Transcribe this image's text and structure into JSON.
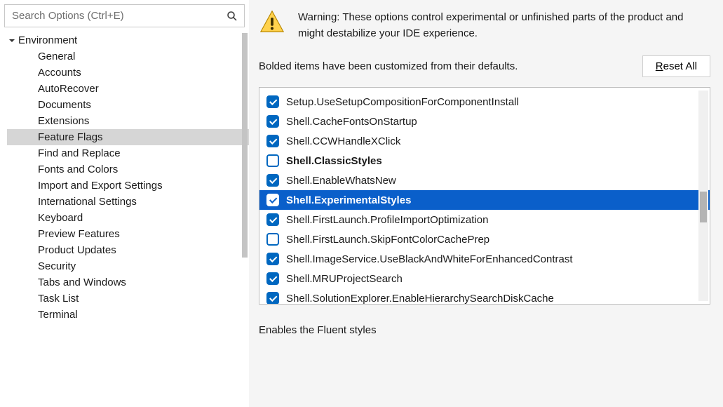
{
  "search": {
    "placeholder": "Search Options (Ctrl+E)"
  },
  "tree": {
    "root_label": "Environment",
    "children": [
      "General",
      "Accounts",
      "AutoRecover",
      "Documents",
      "Extensions",
      "Feature Flags",
      "Find and Replace",
      "Fonts and Colors",
      "Import and Export Settings",
      "International Settings",
      "Keyboard",
      "Preview Features",
      "Product Updates",
      "Security",
      "Tabs and Windows",
      "Task List",
      "Terminal"
    ],
    "selected_index": 5
  },
  "warning": {
    "text": "Warning: These options control experimental or unfinished parts of the product and might destabilize your IDE experience."
  },
  "info_text": "Bolded items have been customized from their defaults.",
  "reset_button": {
    "mnemonic": "R",
    "rest": "eset All"
  },
  "flags": [
    {
      "name": "Setup.UseSetupCompositionForComponentInstall",
      "checked": true,
      "bold": false,
      "selected": false
    },
    {
      "name": "Shell.CacheFontsOnStartup",
      "checked": true,
      "bold": false,
      "selected": false
    },
    {
      "name": "Shell.CCWHandleXClick",
      "checked": true,
      "bold": false,
      "selected": false
    },
    {
      "name": "Shell.ClassicStyles",
      "checked": false,
      "bold": true,
      "selected": false
    },
    {
      "name": "Shell.EnableWhatsNew",
      "checked": true,
      "bold": false,
      "selected": false
    },
    {
      "name": "Shell.ExperimentalStyles",
      "checked": true,
      "bold": true,
      "selected": true
    },
    {
      "name": "Shell.FirstLaunch.ProfileImportOptimization",
      "checked": true,
      "bold": false,
      "selected": false
    },
    {
      "name": "Shell.FirstLaunch.SkipFontColorCachePrep",
      "checked": false,
      "bold": false,
      "selected": false
    },
    {
      "name": "Shell.ImageService.UseBlackAndWhiteForEnhancedContrast",
      "checked": true,
      "bold": false,
      "selected": false
    },
    {
      "name": "Shell.MRUProjectSearch",
      "checked": true,
      "bold": false,
      "selected": false
    },
    {
      "name": "Shell.SolutionExplorer.EnableHierarchySearchDiskCache",
      "checked": true,
      "bold": false,
      "selected": false
    }
  ],
  "description": "Enables the Fluent styles"
}
